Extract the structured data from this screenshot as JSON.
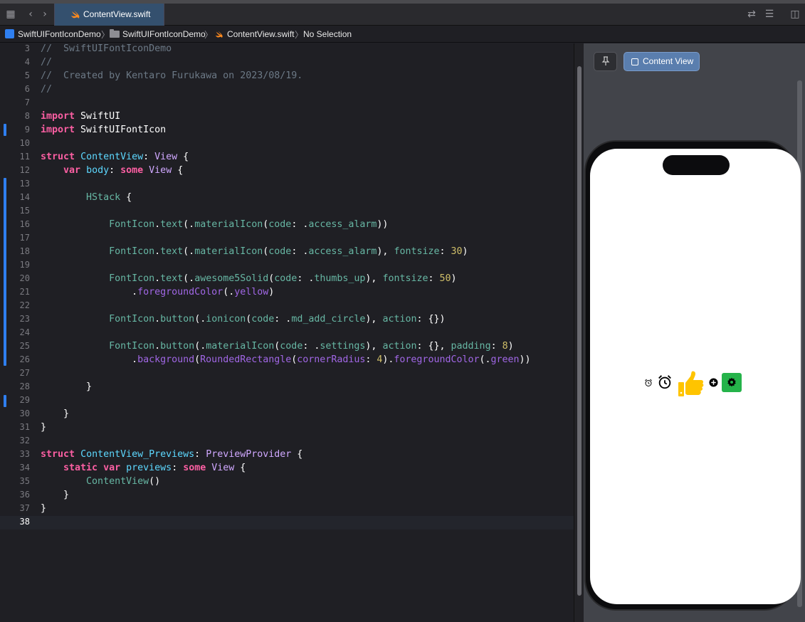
{
  "tab": {
    "title": "ContentView.swift"
  },
  "breadcrumb": {
    "project": "SwiftUIFontIconDemo",
    "folder": "SwiftUIFontIconDemo",
    "file": "ContentView.swift",
    "selection": "No Selection",
    "separator": "〉"
  },
  "editor": {
    "lines": [
      {
        "n": "3",
        "tokens": [
          [
            "cm",
            "//  SwiftUIFontIconDemo"
          ]
        ]
      },
      {
        "n": "4",
        "tokens": [
          [
            "cm",
            "//"
          ]
        ]
      },
      {
        "n": "5",
        "tokens": [
          [
            "cm",
            "//  Created by Kentaro Furukawa on 2023/08/19."
          ]
        ]
      },
      {
        "n": "6",
        "tokens": [
          [
            "cm",
            "//"
          ]
        ]
      },
      {
        "n": "7",
        "tokens": []
      },
      {
        "n": "8",
        "tokens": [
          [
            "kw",
            "import"
          ],
          [
            "plain",
            " SwiftUI"
          ]
        ]
      },
      {
        "n": "9",
        "tokens": [
          [
            "kw",
            "import"
          ],
          [
            "plain",
            " SwiftUIFontIcon"
          ]
        ]
      },
      {
        "n": "10",
        "tokens": []
      },
      {
        "n": "11",
        "tokens": [
          [
            "kw",
            "struct"
          ],
          [
            "plain",
            " "
          ],
          [
            "ty",
            "ContentView"
          ],
          [
            "plain",
            ": "
          ],
          [
            "prj",
            "View"
          ],
          [
            "plain",
            " {"
          ]
        ]
      },
      {
        "n": "12",
        "tokens": [
          [
            "plain",
            "    "
          ],
          [
            "kw",
            "var"
          ],
          [
            "plain",
            " "
          ],
          [
            "ty",
            "body"
          ],
          [
            "plain",
            ": "
          ],
          [
            "kw",
            "some"
          ],
          [
            "plain",
            " "
          ],
          [
            "prj",
            "View"
          ],
          [
            "plain",
            " {"
          ]
        ]
      },
      {
        "n": "13",
        "tokens": []
      },
      {
        "n": "14",
        "tokens": [
          [
            "plain",
            "        "
          ],
          [
            "fn",
            "HStack"
          ],
          [
            "plain",
            " {"
          ]
        ]
      },
      {
        "n": "15",
        "tokens": []
      },
      {
        "n": "16",
        "tokens": [
          [
            "plain",
            "            "
          ],
          [
            "fn",
            "FontIcon"
          ],
          [
            "plain",
            "."
          ],
          [
            "fn",
            "text"
          ],
          [
            "plain",
            "(."
          ],
          [
            "fn",
            "materialIcon"
          ],
          [
            "plain",
            "("
          ],
          [
            "fn",
            "code"
          ],
          [
            "plain",
            ": ."
          ],
          [
            "fn",
            "access_alarm"
          ],
          [
            "plain",
            "))"
          ]
        ]
      },
      {
        "n": "17",
        "tokens": []
      },
      {
        "n": "18",
        "tokens": [
          [
            "plain",
            "            "
          ],
          [
            "fn",
            "FontIcon"
          ],
          [
            "plain",
            "."
          ],
          [
            "fn",
            "text"
          ],
          [
            "plain",
            "(."
          ],
          [
            "fn",
            "materialIcon"
          ],
          [
            "plain",
            "("
          ],
          [
            "fn",
            "code"
          ],
          [
            "plain",
            ": ."
          ],
          [
            "fn",
            "access_alarm"
          ],
          [
            "plain",
            "), "
          ],
          [
            "fn",
            "fontsize"
          ],
          [
            "plain",
            ": "
          ],
          [
            "num",
            "30"
          ],
          [
            "plain",
            ")"
          ]
        ]
      },
      {
        "n": "19",
        "tokens": []
      },
      {
        "n": "20",
        "tokens": [
          [
            "plain",
            "            "
          ],
          [
            "fn",
            "FontIcon"
          ],
          [
            "plain",
            "."
          ],
          [
            "fn",
            "text"
          ],
          [
            "plain",
            "(."
          ],
          [
            "fn",
            "awesome5Solid"
          ],
          [
            "plain",
            "("
          ],
          [
            "fn",
            "code"
          ],
          [
            "plain",
            ": ."
          ],
          [
            "fn",
            "thumbs_up"
          ],
          [
            "plain",
            "), "
          ],
          [
            "fn",
            "fontsize"
          ],
          [
            "plain",
            ": "
          ],
          [
            "num",
            "50"
          ],
          [
            "plain",
            ")"
          ]
        ]
      },
      {
        "n": "21",
        "tokens": [
          [
            "plain",
            "                ."
          ],
          [
            "mem",
            "foregroundColor"
          ],
          [
            "plain",
            "(."
          ],
          [
            "mem",
            "yellow"
          ],
          [
            "plain",
            ")"
          ]
        ]
      },
      {
        "n": "22",
        "tokens": []
      },
      {
        "n": "23",
        "tokens": [
          [
            "plain",
            "            "
          ],
          [
            "fn",
            "FontIcon"
          ],
          [
            "plain",
            "."
          ],
          [
            "fn",
            "button"
          ],
          [
            "plain",
            "(."
          ],
          [
            "fn",
            "ionicon"
          ],
          [
            "plain",
            "("
          ],
          [
            "fn",
            "code"
          ],
          [
            "plain",
            ": ."
          ],
          [
            "fn",
            "md_add_circle"
          ],
          [
            "plain",
            "), "
          ],
          [
            "fn",
            "action"
          ],
          [
            "plain",
            ": {})"
          ]
        ]
      },
      {
        "n": "24",
        "tokens": []
      },
      {
        "n": "25",
        "tokens": [
          [
            "plain",
            "            "
          ],
          [
            "fn",
            "FontIcon"
          ],
          [
            "plain",
            "."
          ],
          [
            "fn",
            "button"
          ],
          [
            "plain",
            "(."
          ],
          [
            "fn",
            "materialIcon"
          ],
          [
            "plain",
            "("
          ],
          [
            "fn",
            "code"
          ],
          [
            "plain",
            ": ."
          ],
          [
            "fn",
            "settings"
          ],
          [
            "plain",
            "), "
          ],
          [
            "fn",
            "action"
          ],
          [
            "plain",
            ": {}, "
          ],
          [
            "fn",
            "padding"
          ],
          [
            "plain",
            ": "
          ],
          [
            "num",
            "8"
          ],
          [
            "plain",
            ")"
          ]
        ]
      },
      {
        "n": "26",
        "tokens": [
          [
            "plain",
            "                ."
          ],
          [
            "mem",
            "background"
          ],
          [
            "plain",
            "("
          ],
          [
            "mem",
            "RoundedRectangle"
          ],
          [
            "plain",
            "("
          ],
          [
            "mem",
            "cornerRadius"
          ],
          [
            "plain",
            ": "
          ],
          [
            "num",
            "4"
          ],
          [
            "plain",
            ")."
          ],
          [
            "mem",
            "foregroundColor"
          ],
          [
            "plain",
            "(."
          ],
          [
            "mem",
            "green"
          ],
          [
            "plain",
            "))"
          ]
        ]
      },
      {
        "n": "27",
        "tokens": []
      },
      {
        "n": "28",
        "tokens": [
          [
            "plain",
            "        }"
          ]
        ]
      },
      {
        "n": "29",
        "tokens": []
      },
      {
        "n": "30",
        "tokens": [
          [
            "plain",
            "    }"
          ]
        ]
      },
      {
        "n": "31",
        "tokens": [
          [
            "plain",
            "}"
          ]
        ]
      },
      {
        "n": "32",
        "tokens": []
      },
      {
        "n": "33",
        "tokens": [
          [
            "kw",
            "struct"
          ],
          [
            "plain",
            " "
          ],
          [
            "ty",
            "ContentView_Previews"
          ],
          [
            "plain",
            ": "
          ],
          [
            "prj",
            "PreviewProvider"
          ],
          [
            "plain",
            " {"
          ]
        ]
      },
      {
        "n": "34",
        "tokens": [
          [
            "plain",
            "    "
          ],
          [
            "kw",
            "static"
          ],
          [
            "plain",
            " "
          ],
          [
            "kw",
            "var"
          ],
          [
            "plain",
            " "
          ],
          [
            "ty",
            "previews"
          ],
          [
            "plain",
            ": "
          ],
          [
            "kw",
            "some"
          ],
          [
            "plain",
            " "
          ],
          [
            "prj",
            "View"
          ],
          [
            "plain",
            " {"
          ]
        ]
      },
      {
        "n": "35",
        "tokens": [
          [
            "plain",
            "        "
          ],
          [
            "fn",
            "ContentView"
          ],
          [
            "plain",
            "()"
          ]
        ]
      },
      {
        "n": "36",
        "tokens": [
          [
            "plain",
            "    }"
          ]
        ]
      },
      {
        "n": "37",
        "tokens": [
          [
            "plain",
            "}"
          ]
        ]
      },
      {
        "n": "38",
        "tokens": []
      }
    ],
    "current_line": "38"
  },
  "canvas": {
    "pin_icon": "pin-icon",
    "preview_button": "Content View",
    "preview_icons": [
      "alarm-icon",
      "alarm-icon",
      "thumbs-up-icon",
      "add-circle-icon",
      "settings-icon"
    ],
    "colors": {
      "thumbs_up": "#ffc400",
      "settings_bg": "#25b34a"
    }
  }
}
